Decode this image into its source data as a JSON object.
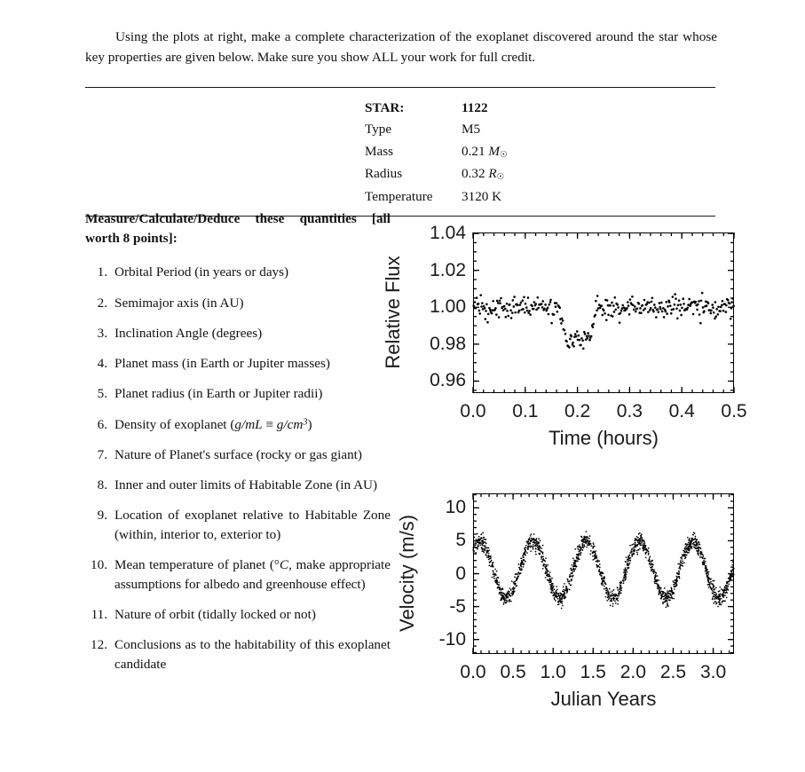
{
  "document": {
    "intro_paragraph": "Using the plots at right, make a complete characterization of the exoplanet discovered around the star whose key properties are given below. Make sure you show ALL your work for full credit."
  },
  "star_table": {
    "rows": [
      {
        "key": "STAR:",
        "value": "1122",
        "bold": true
      },
      {
        "key": "Type",
        "value": "M5"
      },
      {
        "key": "Mass",
        "value": "0.21 M⊙"
      },
      {
        "key": "Radius",
        "value": "0.32 R⊙"
      },
      {
        "key": "Temperature",
        "value": "3120 K"
      }
    ],
    "mass_number": "0.21",
    "mass_symbol": "M",
    "radius_number": "0.32",
    "radius_symbol": "R",
    "type_value": "M5",
    "star_id": "1122",
    "temperature_value": "3120 K",
    "star_label": "STAR:",
    "type_label": "Type",
    "mass_label": "Mass",
    "radius_label": "Radius",
    "temperature_label": "Temperature"
  },
  "tasks": {
    "heading": "Measure/Calculate/Deduce these quantities [all worth 8 points]:",
    "items": [
      {
        "n": "1.",
        "text": "Orbital Period (in years or days)"
      },
      {
        "n": "2.",
        "text": "Semimajor axis (in AU)"
      },
      {
        "n": "3.",
        "text": "Inclination Angle (degrees)"
      },
      {
        "n": "4.",
        "text": "Planet mass (in Earth or Jupiter masses)"
      },
      {
        "n": "5.",
        "text": "Planet radius (in Earth or Jupiter radii)"
      },
      {
        "n": "6.",
        "text": "Density of exoplanet (g/mL ≡ g/cm³)"
      },
      {
        "n": "7.",
        "text": "Nature of Planet's surface (rocky or gas giant)"
      },
      {
        "n": "8.",
        "text": "Inner and outer limits of Habitable Zone (in AU)"
      },
      {
        "n": "9.",
        "text": "Location of exoplanet relative to Habitable Zone (within, interior to, exterior to)"
      },
      {
        "n": "10.",
        "text": "Mean temperature of planet (°C, make appropriate assumptions for albedo and greenhouse effect)"
      },
      {
        "n": "11.",
        "text": "Nature of orbit (tidally locked or not)"
      },
      {
        "n": "12.",
        "text": "Conclusions as to the habitability of this exoplanet candidate"
      }
    ]
  },
  "chart_data": [
    {
      "id": "transit-light-curve",
      "type": "scatter",
      "title": "",
      "xlabel": "Time (hours)",
      "ylabel": "Relative Flux",
      "xlim": [
        0.0,
        0.5
      ],
      "ylim": [
        0.9535,
        1.0405
      ],
      "xticks": [
        0.0,
        0.1,
        0.2,
        0.3,
        0.4,
        0.5
      ],
      "xtick_labels": [
        "0.0",
        "0.1",
        "0.2",
        "0.3",
        "0.4",
        "0.5"
      ],
      "yticks": [
        0.96,
        0.98,
        1.0,
        1.02,
        1.04
      ],
      "ytick_labels": [
        "0.96",
        "0.98",
        "1.00",
        "1.02",
        "1.04"
      ],
      "x_minor_per_major": 5,
      "y_minor_per_major": 4,
      "grid": false,
      "legend": false,
      "marker_color": "#000000",
      "marker_size_px": 2.6,
      "n_points": 330,
      "model": {
        "baseline_flux": 1.0,
        "transit_depth": 0.0175,
        "ingress_start": 0.163,
        "ingress_end": 0.178,
        "egress_start": 0.222,
        "egress_end": 0.237,
        "noise_sigma": 0.0028,
        "duration_hours": 0.074
      }
    },
    {
      "id": "radial-velocity-curve",
      "type": "scatter",
      "title": "",
      "xlabel": "Julian Years",
      "ylabel": "Velocity (m/s)",
      "xlim": [
        0.0,
        3.26
      ],
      "ylim": [
        -12.2,
        12.2
      ],
      "xticks": [
        0.0,
        0.5,
        1.0,
        1.5,
        2.0,
        2.5,
        3.0
      ],
      "xtick_labels": [
        "0.0",
        "0.5",
        "1.0",
        "1.5",
        "2.0",
        "2.5",
        "3.0"
      ],
      "yticks": [
        -10,
        -5,
        0,
        5,
        10
      ],
      "ytick_labels": [
        "-10",
        "-5",
        "0",
        "5",
        "10"
      ],
      "x_minor_per_major": 5,
      "y_minor_per_major": 5,
      "grid": false,
      "legend": false,
      "marker_color": "#000000",
      "marker_size_px": 1.7,
      "n_points": 1800,
      "model": {
        "semi_amplitude": 4.3,
        "offset": 0.6,
        "period_years": 0.665,
        "phase_peak_years": 0.085,
        "noise_sigma": 0.62,
        "peaks_at": [
          0.085,
          0.75,
          1.415,
          2.08,
          2.745
        ],
        "troughs_at": [
          0.418,
          1.083,
          1.748,
          2.413,
          3.078
        ]
      }
    }
  ]
}
